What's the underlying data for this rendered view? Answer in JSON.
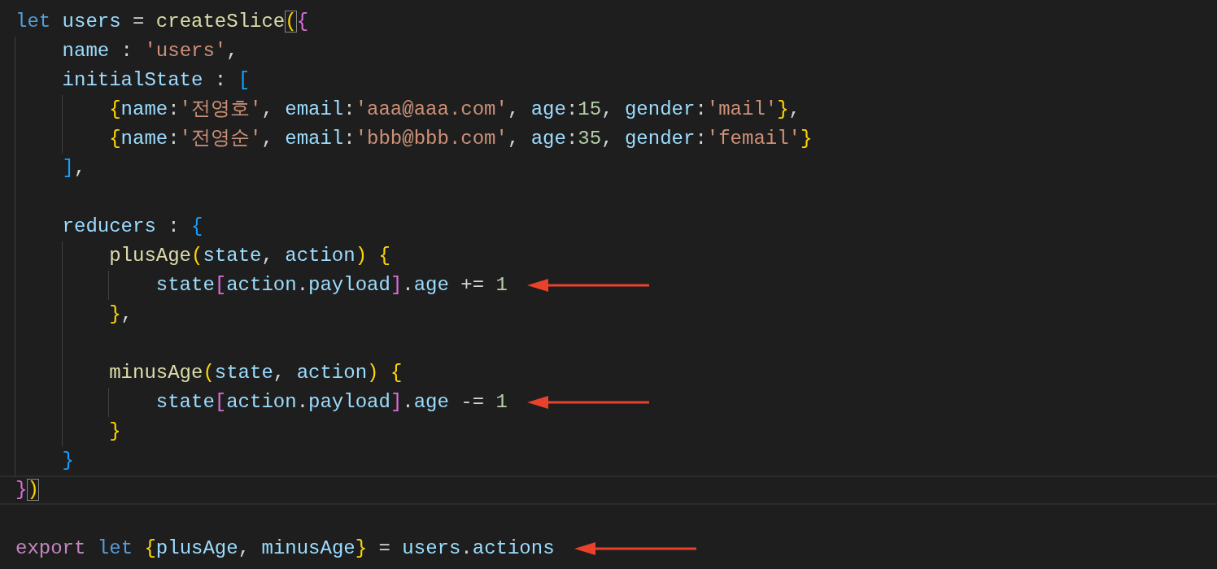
{
  "editor": {
    "lines": [
      {
        "kind": "code",
        "tokens": [
          {
            "kind": "keyword",
            "text": "let "
          },
          {
            "kind": "variable",
            "text": "users"
          },
          {
            "kind": "plain",
            "text": " = "
          },
          {
            "kind": "function",
            "text": "createSlice"
          },
          {
            "kind": "bracket1",
            "text": "(",
            "matched": true
          },
          {
            "kind": "bracket2",
            "text": "{"
          }
        ],
        "children": [
          {
            "kind": "code",
            "tokens": [
              {
                "kind": "property",
                "text": "name"
              },
              {
                "kind": "plain",
                "text": " : "
              },
              {
                "kind": "string",
                "text": "'users'"
              },
              {
                "kind": "plain",
                "text": ","
              }
            ]
          },
          {
            "kind": "code",
            "tokens": [
              {
                "kind": "property",
                "text": "initialState"
              },
              {
                "kind": "plain",
                "text": " : "
              },
              {
                "kind": "bracket3",
                "text": "["
              }
            ],
            "children": [
              {
                "kind": "code",
                "tokens": [
                  {
                    "kind": "bracket1",
                    "text": "{"
                  },
                  {
                    "kind": "property",
                    "text": "name"
                  },
                  {
                    "kind": "plain",
                    "text": ":"
                  },
                  {
                    "kind": "string",
                    "text": "'전영호'"
                  },
                  {
                    "kind": "plain",
                    "text": ", "
                  },
                  {
                    "kind": "property",
                    "text": "email"
                  },
                  {
                    "kind": "plain",
                    "text": ":"
                  },
                  {
                    "kind": "string",
                    "text": "'aaa@aaa.com'"
                  },
                  {
                    "kind": "plain",
                    "text": ", "
                  },
                  {
                    "kind": "property",
                    "text": "age"
                  },
                  {
                    "kind": "plain",
                    "text": ":"
                  },
                  {
                    "kind": "number",
                    "text": "15"
                  },
                  {
                    "kind": "plain",
                    "text": ", "
                  },
                  {
                    "kind": "property",
                    "text": "gender"
                  },
                  {
                    "kind": "plain",
                    "text": ":"
                  },
                  {
                    "kind": "string",
                    "text": "'mail'"
                  },
                  {
                    "kind": "bracket1",
                    "text": "}"
                  },
                  {
                    "kind": "plain",
                    "text": ","
                  }
                ]
              },
              {
                "kind": "code",
                "tokens": [
                  {
                    "kind": "bracket1",
                    "text": "{"
                  },
                  {
                    "kind": "property",
                    "text": "name"
                  },
                  {
                    "kind": "plain",
                    "text": ":"
                  },
                  {
                    "kind": "string",
                    "text": "'전영순'"
                  },
                  {
                    "kind": "plain",
                    "text": ", "
                  },
                  {
                    "kind": "property",
                    "text": "email"
                  },
                  {
                    "kind": "plain",
                    "text": ":"
                  },
                  {
                    "kind": "string",
                    "text": "'bbb@bbb.com'"
                  },
                  {
                    "kind": "plain",
                    "text": ", "
                  },
                  {
                    "kind": "property",
                    "text": "age"
                  },
                  {
                    "kind": "plain",
                    "text": ":"
                  },
                  {
                    "kind": "number",
                    "text": "35"
                  },
                  {
                    "kind": "plain",
                    "text": ", "
                  },
                  {
                    "kind": "property",
                    "text": "gender"
                  },
                  {
                    "kind": "plain",
                    "text": ":"
                  },
                  {
                    "kind": "string",
                    "text": "'femail'"
                  },
                  {
                    "kind": "bracket1",
                    "text": "}"
                  }
                ]
              }
            ]
          },
          {
            "kind": "code",
            "tokens": [
              {
                "kind": "bracket3",
                "text": "]"
              },
              {
                "kind": "plain",
                "text": ","
              }
            ]
          },
          {
            "kind": "blank"
          },
          {
            "kind": "code",
            "tokens": [
              {
                "kind": "property",
                "text": "reducers"
              },
              {
                "kind": "plain",
                "text": " : "
              },
              {
                "kind": "bracket3",
                "text": "{"
              }
            ],
            "children": [
              {
                "kind": "code",
                "tokens": [
                  {
                    "kind": "function",
                    "text": "plusAge"
                  },
                  {
                    "kind": "bracket1",
                    "text": "("
                  },
                  {
                    "kind": "variable",
                    "text": "state"
                  },
                  {
                    "kind": "plain",
                    "text": ", "
                  },
                  {
                    "kind": "variable",
                    "text": "action"
                  },
                  {
                    "kind": "bracket1",
                    "text": ") "
                  },
                  {
                    "kind": "bracket1",
                    "text": "{"
                  }
                ],
                "children": [
                  {
                    "kind": "code",
                    "arrow": true,
                    "tokens": [
                      {
                        "kind": "variable",
                        "text": "state"
                      },
                      {
                        "kind": "bracket2",
                        "text": "["
                      },
                      {
                        "kind": "variable",
                        "text": "action"
                      },
                      {
                        "kind": "plain",
                        "text": "."
                      },
                      {
                        "kind": "property",
                        "text": "payload"
                      },
                      {
                        "kind": "bracket2",
                        "text": "]"
                      },
                      {
                        "kind": "plain",
                        "text": "."
                      },
                      {
                        "kind": "property",
                        "text": "age"
                      },
                      {
                        "kind": "plain",
                        "text": " += "
                      },
                      {
                        "kind": "number",
                        "text": "1"
                      }
                    ]
                  }
                ]
              },
              {
                "kind": "code",
                "tokens": [
                  {
                    "kind": "bracket1",
                    "text": "}"
                  },
                  {
                    "kind": "plain",
                    "text": ","
                  }
                ]
              },
              {
                "kind": "blank"
              },
              {
                "kind": "code",
                "tokens": [
                  {
                    "kind": "function",
                    "text": "minusAge"
                  },
                  {
                    "kind": "bracket1",
                    "text": "("
                  },
                  {
                    "kind": "variable",
                    "text": "state"
                  },
                  {
                    "kind": "plain",
                    "text": ", "
                  },
                  {
                    "kind": "variable",
                    "text": "action"
                  },
                  {
                    "kind": "bracket1",
                    "text": ") "
                  },
                  {
                    "kind": "bracket1",
                    "text": "{"
                  }
                ],
                "children": [
                  {
                    "kind": "code",
                    "arrow": true,
                    "tokens": [
                      {
                        "kind": "variable",
                        "text": "state"
                      },
                      {
                        "kind": "bracket2",
                        "text": "["
                      },
                      {
                        "kind": "variable",
                        "text": "action"
                      },
                      {
                        "kind": "plain",
                        "text": "."
                      },
                      {
                        "kind": "property",
                        "text": "payload"
                      },
                      {
                        "kind": "bracket2",
                        "text": "]"
                      },
                      {
                        "kind": "plain",
                        "text": "."
                      },
                      {
                        "kind": "property",
                        "text": "age"
                      },
                      {
                        "kind": "plain",
                        "text": " -= "
                      },
                      {
                        "kind": "number",
                        "text": "1"
                      }
                    ]
                  }
                ]
              },
              {
                "kind": "code",
                "tokens": [
                  {
                    "kind": "bracket1",
                    "text": "}"
                  }
                ]
              }
            ]
          },
          {
            "kind": "code",
            "tokens": [
              {
                "kind": "bracket3",
                "text": "}"
              }
            ]
          }
        ]
      },
      {
        "kind": "code",
        "current": true,
        "tokens": [
          {
            "kind": "bracket2",
            "text": "}"
          },
          {
            "kind": "bracket1",
            "text": ")",
            "matched": true
          }
        ]
      },
      {
        "kind": "blank"
      },
      {
        "kind": "code",
        "arrow": true,
        "tokens": [
          {
            "kind": "control",
            "text": "export "
          },
          {
            "kind": "keyword",
            "text": "let "
          },
          {
            "kind": "bracket1",
            "text": "{"
          },
          {
            "kind": "variable",
            "text": "plusAge"
          },
          {
            "kind": "plain",
            "text": ", "
          },
          {
            "kind": "variable",
            "text": "minusAge"
          },
          {
            "kind": "bracket1",
            "text": "}"
          },
          {
            "kind": "plain",
            "text": " = "
          },
          {
            "kind": "variable",
            "text": "users"
          },
          {
            "kind": "plain",
            "text": "."
          },
          {
            "kind": "property",
            "text": "actions"
          }
        ]
      }
    ]
  }
}
